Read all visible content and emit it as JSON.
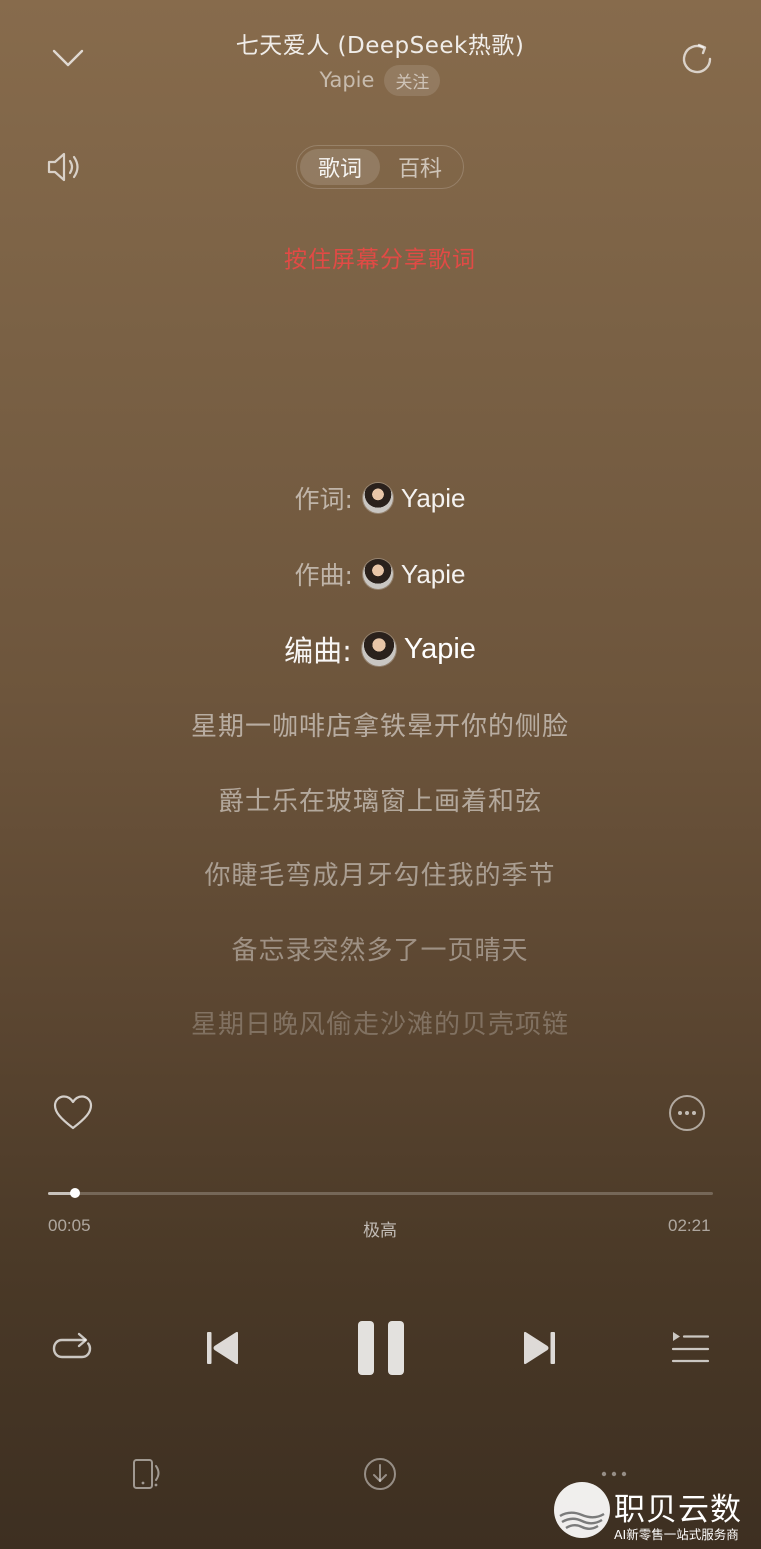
{
  "header": {
    "title": "七天爱人 (DeepSeek热歌)",
    "artist": "Yapie",
    "follow_label": "关注",
    "collapse_icon": "chevron-down-icon",
    "refresh_icon": "refresh-icon"
  },
  "toolbar": {
    "volume_icon": "volume-icon",
    "tabs": [
      {
        "label": "歌词",
        "active": true
      },
      {
        "label": "百科",
        "active": false
      }
    ]
  },
  "share_hint": "按住屏幕分享歌词",
  "credits": [
    {
      "key": "作词:",
      "value": "Yapie"
    },
    {
      "key": "作曲:",
      "value": "Yapie"
    },
    {
      "key": "编曲:",
      "value": "Yapie"
    }
  ],
  "lyrics": [
    "星期一咖啡店拿铁晕开你的侧脸",
    "爵士乐在玻璃窗上画着和弦",
    "你睫毛弯成月牙勾住我的季节",
    "备忘录突然多了一页晴天",
    "星期日晚风偷走沙滩的贝壳项链"
  ],
  "actions": {
    "like_icon": "heart-icon",
    "more_icon": "more-circle-icon"
  },
  "progress": {
    "current": "00:05",
    "total": "02:21",
    "quality": "极高",
    "fraction": 0.04
  },
  "controls": {
    "repeat_icon": "repeat-icon",
    "prev_icon": "previous-icon",
    "pause_icon": "pause-icon",
    "next_icon": "next-icon",
    "playlist_icon": "playlist-icon"
  },
  "bottom_bar": {
    "device_icon": "device-icon",
    "download_icon": "download-icon",
    "more_icon": "more-dots-icon"
  },
  "watermark": {
    "name": "职贝云数",
    "tagline": "AI新零售一站式服务商"
  },
  "colors": {
    "accent_hint": "#e24a45",
    "background_top": "#876b4c",
    "background_bottom": "#3d2f21"
  }
}
